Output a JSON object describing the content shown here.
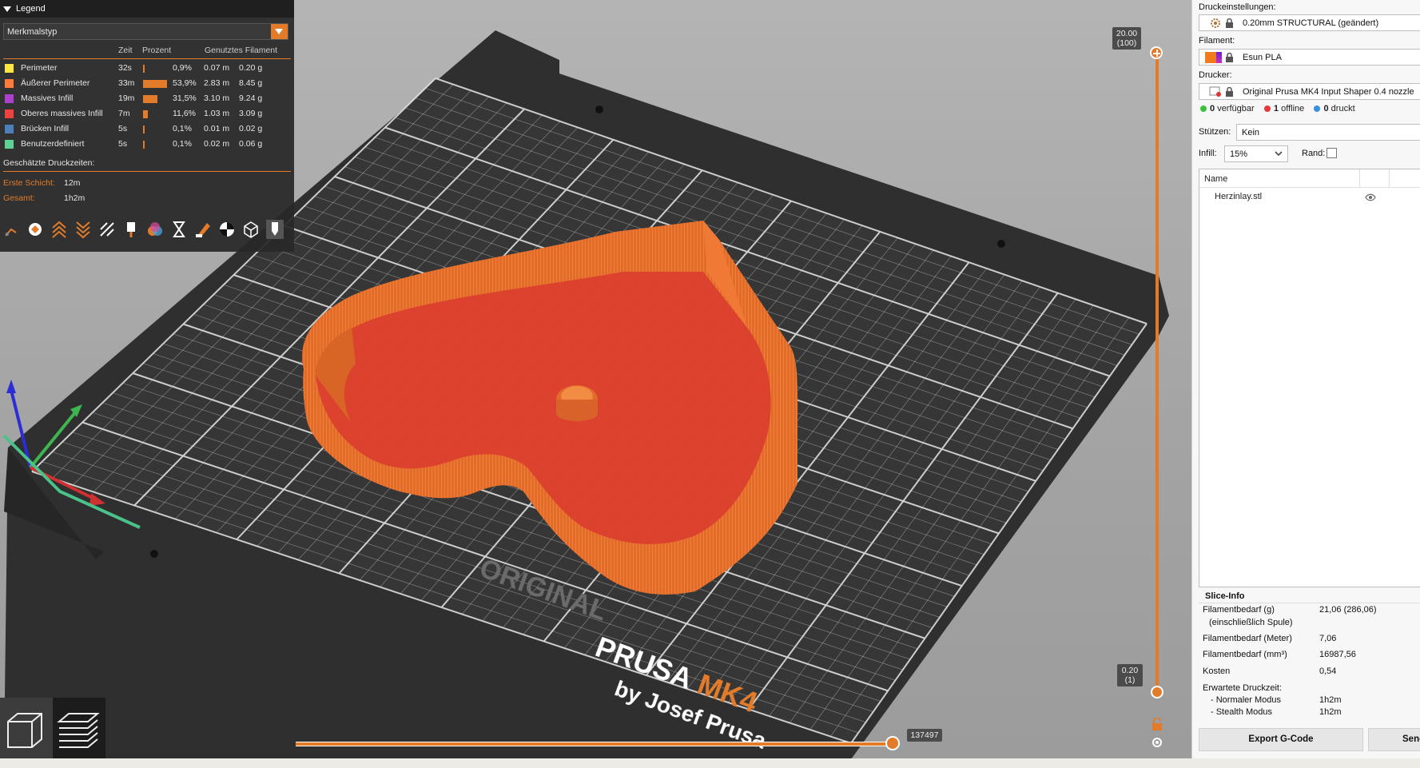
{
  "legend": {
    "title": "Legend",
    "view_type": "Merkmalstyp",
    "columns": {
      "time": "Zeit",
      "percent": "Prozent",
      "filament": "Genutztes Filament"
    },
    "features": [
      {
        "name": "Perimeter",
        "time": "32s",
        "percent": "0,9%",
        "length": "0.07 m",
        "weight": "0.20 g",
        "color": "#FFE640",
        "share": 0.009
      },
      {
        "name": "Äußerer Perimeter",
        "time": "33m",
        "percent": "53,9%",
        "length": "2.83 m",
        "weight": "8.45 g",
        "color": "#FF7D38",
        "share": 0.539
      },
      {
        "name": "Massives Infill",
        "time": "19m",
        "percent": "31,5%",
        "length": "3.10 m",
        "weight": "9.24 g",
        "color": "#B03FD0",
        "share": 0.315
      },
      {
        "name": "Oberes massives Infill",
        "time": "7m",
        "percent": "11,6%",
        "length": "1.03 m",
        "weight": "3.09 g",
        "color": "#F04141",
        "share": 0.116
      },
      {
        "name": "Brücken Infill",
        "time": "5s",
        "percent": "0,1%",
        "length": "0.01 m",
        "weight": "0.02 g",
        "color": "#4D80BA",
        "share": 0.001
      },
      {
        "name": "Benutzerdefiniert",
        "time": "5s",
        "percent": "0,1%",
        "length": "0.02 m",
        "weight": "0.06 g",
        "color": "#5ED194",
        "share": 0.001
      }
    ],
    "estimated_times_label": "Geschätzte Druckzeiten:",
    "first_layer_label": "Erste Schicht:",
    "first_layer_value": "12m",
    "total_label": "Gesamt:",
    "total_value": "1h2m"
  },
  "sliders": {
    "top_value": "20.00",
    "top_layer": "(100)",
    "bottom_value": "0.20",
    "bottom_layer": "(1)",
    "horizontal_value": "137497"
  },
  "bed_logo": {
    "line1": "ORIGINAL",
    "line2a": "PRUSA",
    "line2b": "MK4",
    "line3": "by Josef Prusa"
  },
  "panel": {
    "print_settings_label": "Druckeinstellungen:",
    "print_settings_value": "0.20mm STRUCTURAL (geändert)",
    "filament_label": "Filament:",
    "filament_value": "Esun PLA",
    "printer_label": "Drucker:",
    "printer_value": "Original Prusa MK4 Input Shaper 0.4 nozzle",
    "status": {
      "available_count": "0",
      "available_label": "verfügbar",
      "offline_count": "1",
      "offline_label": "offline",
      "printing_count": "0",
      "printing_label": "druckt"
    },
    "supports_label": "Stützen:",
    "supports_value": "Kein",
    "infill_label": "Infill:",
    "infill_value": "15%",
    "brim_label": "Rand:",
    "object_list_header": "Name",
    "objects": [
      {
        "name": "Herzinlay.stl"
      }
    ],
    "slice_info": {
      "title": "Slice-Info",
      "filament_g_label": "Filamentbedarf (g)",
      "filament_g_sub": "(einschließlich Spule)",
      "filament_g_value": "21,06 (286,06)",
      "filament_m_label": "Filamentbedarf (Meter)",
      "filament_m_value": "7,06",
      "filament_mm3_label": "Filamentbedarf (mm³)",
      "filament_mm3_value": "16987,56",
      "cost_label": "Kosten",
      "cost_value": "0,54",
      "time_label": "Erwartete Druckzeit:",
      "normal_label": "- Normaler Modus",
      "normal_value": "1h2m",
      "stealth_label": "- Stealth Modus",
      "stealth_value": "1h2m"
    },
    "export_button": "Export G-Code",
    "send_button": "Senden"
  },
  "colors": {
    "accent": "#e27b2a",
    "outer_perimeter": "#e8772e",
    "top_infill": "#e84a3a",
    "bed": "#2f2f2f"
  }
}
